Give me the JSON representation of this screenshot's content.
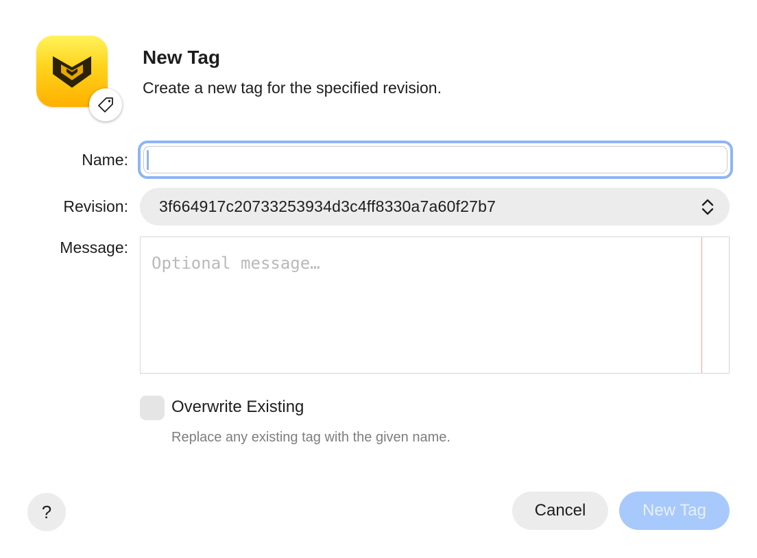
{
  "dialog": {
    "title": "New Tag",
    "subtitle": "Create a new tag for the specified revision."
  },
  "icons": {
    "app": "app-logo-icon",
    "badge": "tag-icon",
    "revision_popup": "chevron-up-down-icon"
  },
  "fields": {
    "name": {
      "label": "Name:",
      "value": "",
      "placeholder": ""
    },
    "revision": {
      "label": "Revision:",
      "value": "3f664917c20733253934d3c4ff8330a7a60f27b7"
    },
    "message": {
      "label": "Message:",
      "value": "",
      "placeholder": "Optional message…"
    }
  },
  "overwrite": {
    "label": "Overwrite Existing",
    "help": "Replace any existing tag with the given name.",
    "checked": false
  },
  "buttons": {
    "help": "?",
    "cancel": "Cancel",
    "confirm": "New Tag"
  },
  "colors": {
    "focus_ring": "#8fb4f6",
    "primary_disabled": "#a8c9fb",
    "icon_yellow": "#ffd21a",
    "margin_guide": "#e8a0a0"
  }
}
